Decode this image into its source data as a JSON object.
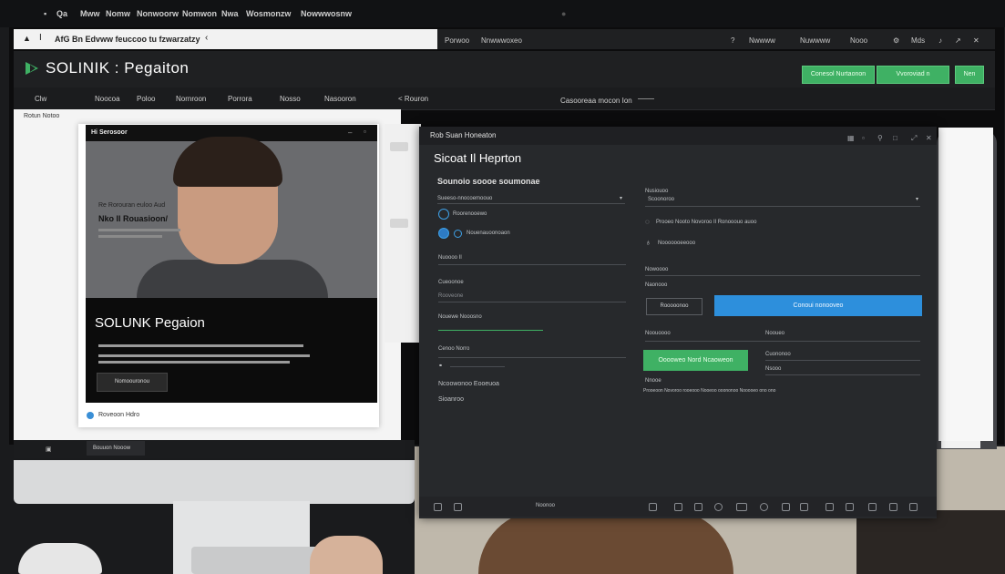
{
  "os_bar": {
    "items": [
      "Q",
      "Qa",
      "Mww",
      "Nomw",
      "Nonwoorw",
      "Nomwon",
      "Nwa",
      "Wosmonzw",
      "Nowwwosnw"
    ]
  },
  "browser": {
    "address": "AfG Bn Edvww feuccoo tu fzwarzatzy",
    "toolbar_left": [
      "Porwoo",
      "Nnwwwoxeo"
    ],
    "toolbar_right": [
      "Nwwww",
      "Nuwwww",
      "Nooo",
      "Mds"
    ]
  },
  "app": {
    "logo_text": "SOLINIK : Pegaiton",
    "header_buttons": [
      "Conesol Nurtaonon",
      "Vvoroviad n",
      "Nen"
    ],
    "nav": [
      "Clw",
      "Noocoa",
      "Poloo",
      "Nornroon",
      "Porrora",
      "Nosso",
      "Nasooron",
      "< Rouron"
    ],
    "search_label": "Casooreaa mocon Ion",
    "breadcrumb": "Rotun Notoo"
  },
  "card": {
    "header_title": "Hi Serosoor",
    "hero_caption_small": "Re Rorouran euloo Aud",
    "hero_caption_bold": "Nko Il Rouasioon/",
    "title": "SOLUNK Pegaion",
    "button_label": "Nomoouronou",
    "footer_text": "Roveoon Hdro"
  },
  "dark_window": {
    "title": "Rob Suan Honeaton",
    "heading": "Sicoat Il Heprton",
    "subheading": "Sounoio soooe soumonae",
    "left_labels": {
      "dropdown": "Sueeso-nnocoemoouo",
      "radio1": "Roorenooewo",
      "radio2": "Nouenauoonoaon",
      "field1": "Nuoooo Il",
      "field2": "Cueoonoe",
      "field3": "Nouewe Nooosno",
      "field4": "Rooveone",
      "field5": "Cenoo Norro",
      "field6": "Ncoowonoo Eooeuoa",
      "field7": "Sioanroo"
    },
    "right_labels": {
      "dropdown_label": "Nusiouoo",
      "dropdown_value": "Scoonoroo",
      "toggle1": "Prooeo Nooto Novoroo Il Ronooouo auoo",
      "toggle2": "Nooooooeeooo",
      "field1": "Nowoooo",
      "field2": "Naonooo",
      "field3": "Noouoooo",
      "field4": "Nooueo",
      "field5": "Cuononoo",
      "field6": "Nsooo",
      "field7": "Nnooe",
      "footnote": "Prooeoon Novoroo rooeooo Nooeoo ooononoo Nooooeo ono ono"
    },
    "outline_button": "Rooooonoo",
    "blue_button": "Conoui nonooveo",
    "green_button": "Ooooweo Nord Ncaoweon",
    "bottom_center": "Noonoo"
  },
  "left_bottom_tab": "Bouuon Nooow",
  "colors": {
    "brand_green": "#3fb164",
    "accent_blue": "#2d8fdc",
    "dark_bg": "#27292c"
  }
}
